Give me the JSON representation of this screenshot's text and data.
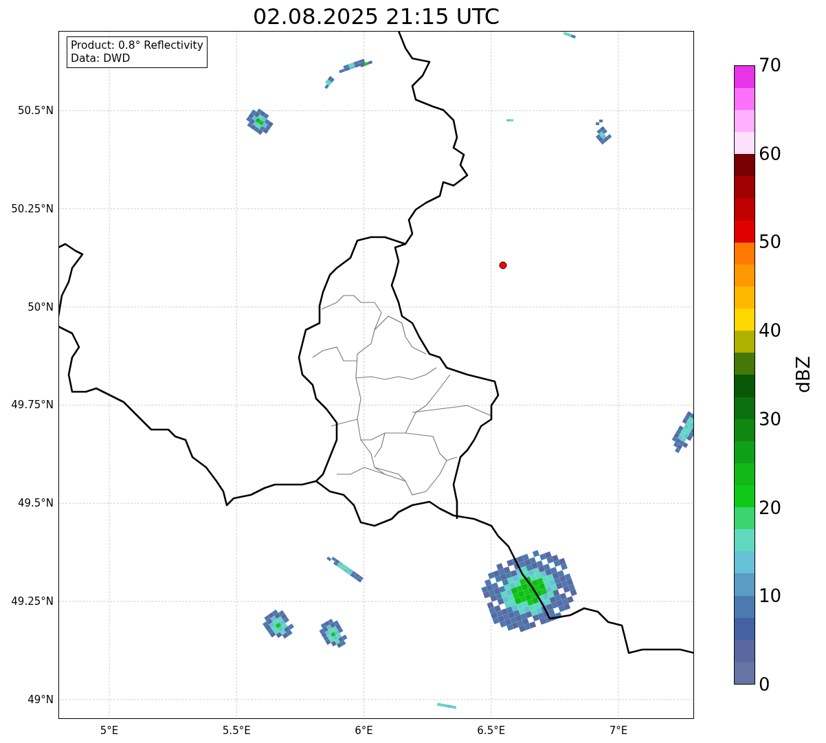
{
  "title": "02.08.2025 21:15 UTC",
  "info_box": [
    "Product: 0.8° Reflectivity",
    "Data: DWD"
  ],
  "map": {
    "x_ticks": [
      "5°E",
      "5.5°E",
      "6°E",
      "6.5°E",
      "7°E"
    ],
    "y_ticks": [
      "50.5°N",
      "50.25°N",
      "50°N",
      "49.75°N",
      "49.5°N",
      "49.25°N",
      "49°N"
    ]
  },
  "colorbar": {
    "label": "dBZ",
    "ticks": [
      "70",
      "60",
      "50",
      "40",
      "30",
      "20",
      "10",
      "0"
    ],
    "bins": [
      {
        "color": "#6474a4"
      },
      {
        "color": "#5968a0"
      },
      {
        "color": "#4461a3"
      },
      {
        "color": "#4a7ab0"
      },
      {
        "color": "#5a9cc4"
      },
      {
        "color": "#66c0d8"
      },
      {
        "color": "#60d8c0"
      },
      {
        "color": "#3cd470"
      },
      {
        "color": "#10c818"
      },
      {
        "color": "#10b818"
      },
      {
        "color": "#10a018"
      },
      {
        "color": "#108810"
      },
      {
        "color": "#0b7010"
      },
      {
        "color": "#085808"
      },
      {
        "color": "#467808"
      },
      {
        "color": "#b0b000"
      },
      {
        "color": "#ffd800"
      },
      {
        "color": "#ffb800"
      },
      {
        "color": "#ff9800"
      },
      {
        "color": "#ff7800"
      },
      {
        "color": "#e00000"
      },
      {
        "color": "#c00000"
      },
      {
        "color": "#a00000"
      },
      {
        "color": "#780000"
      },
      {
        "color": "#ffe0ff"
      },
      {
        "color": "#ffb0ff"
      },
      {
        "color": "#ff70ff"
      },
      {
        "color": "#e833e8"
      }
    ]
  }
}
